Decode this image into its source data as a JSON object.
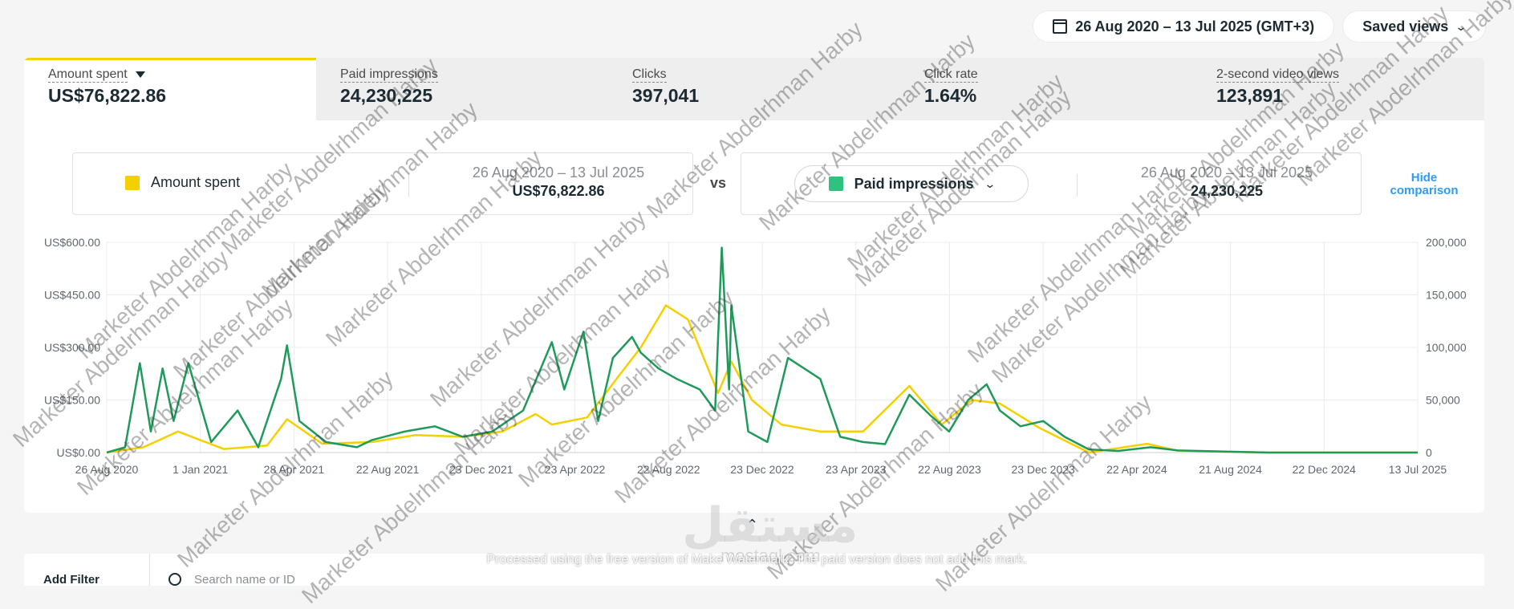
{
  "topbar": {
    "date_range": "26 Aug 2020 – 13 Jul 2025 (GMT+3)",
    "saved_views": "Saved views"
  },
  "metrics": [
    {
      "label": "Amount spent",
      "value": "US$76,822.86"
    },
    {
      "label": "Paid impressions",
      "value": "24,230,225"
    },
    {
      "label": "Clicks",
      "value": "397,041"
    },
    {
      "label": "Click rate",
      "value": "1.64%"
    },
    {
      "label": "2-second video views",
      "value": "123,891"
    }
  ],
  "comparison": {
    "left_metric": "Amount spent",
    "left_range": "26 Aug 2020 – 13 Jul 2025",
    "left_value": "US$76,822.86",
    "vs": "vs",
    "right_metric": "Paid impressions",
    "right_range": "26 Aug 2020 – 13 Jul 2025",
    "right_value": "24,230,225",
    "hide": "Hide comparison"
  },
  "colors": {
    "spend": "#f5d000",
    "impressions": "#1f9a5b"
  },
  "chart_data": {
    "type": "line",
    "x_ticks": [
      "26 Aug 2020",
      "1 Jan 2021",
      "28 Apr 2021",
      "22 Aug 2021",
      "23 Dec 2021",
      "23 Apr 2022",
      "22 Aug 2022",
      "23 Dec 2022",
      "23 Apr 2023",
      "22 Aug 2023",
      "23 Dec 2023",
      "22 Apr 2024",
      "21 Aug 2024",
      "22 Dec 2024",
      "13 Jul 2025"
    ],
    "y_left_ticks": [
      "US$0.00",
      "US$150.00",
      "US$300.00",
      "US$450.00",
      "US$600.00"
    ],
    "y_left_range": [
      0,
      600
    ],
    "y_right_ticks": [
      "0",
      "50,000",
      "100,000",
      "150,000",
      "200,000"
    ],
    "y_right_range": [
      0,
      200000
    ],
    "series": [
      {
        "name": "Amount spent",
        "axis": "left",
        "x": [
          "2020-08-26",
          "2020-10-15",
          "2020-12-01",
          "2021-02-01",
          "2021-04-01",
          "2021-04-28",
          "2021-06-15",
          "2021-08-22",
          "2021-10-20",
          "2021-12-23",
          "2022-02-15",
          "2022-04-01",
          "2022-04-23",
          "2022-06-10",
          "2022-07-20",
          "2022-08-22",
          "2022-09-25",
          "2022-10-25",
          "2022-12-05",
          "2022-12-23",
          "2023-01-20",
          "2023-03-01",
          "2023-04-23",
          "2023-06-20",
          "2023-08-22",
          "2023-10-05",
          "2023-11-15",
          "2023-12-23",
          "2024-02-15",
          "2024-04-22",
          "2024-07-10",
          "2024-08-21",
          "2024-12-22",
          "2025-07-13"
        ],
        "values": [
          0,
          15,
          60,
          10,
          20,
          95,
          25,
          30,
          50,
          45,
          60,
          110,
          80,
          100,
          210,
          300,
          420,
          380,
          170,
          260,
          150,
          80,
          60,
          60,
          190,
          80,
          150,
          140,
          70,
          0,
          25,
          5,
          0,
          0
        ]
      },
      {
        "name": "Paid impressions",
        "axis": "right",
        "x": [
          "2020-08-26",
          "2020-09-20",
          "2020-10-10",
          "2020-10-25",
          "2020-11-10",
          "2020-11-25",
          "2020-12-15",
          "2021-01-15",
          "2021-02-20",
          "2021-03-20",
          "2021-04-20",
          "2021-04-28",
          "2021-05-15",
          "2021-06-20",
          "2021-08-01",
          "2021-08-22",
          "2021-10-05",
          "2021-11-15",
          "2021-12-23",
          "2022-02-01",
          "2022-03-15",
          "2022-04-23",
          "2022-05-10",
          "2022-06-05",
          "2022-06-25",
          "2022-07-15",
          "2022-08-10",
          "2022-08-22",
          "2022-09-15",
          "2022-10-10",
          "2022-11-10",
          "2022-12-01",
          "2022-12-10",
          "2022-12-20",
          "2022-12-23",
          "2023-01-15",
          "2023-02-10",
          "2023-03-10",
          "2023-04-23",
          "2023-05-20",
          "2023-06-20",
          "2023-07-20",
          "2023-08-22",
          "2023-09-20",
          "2023-10-15",
          "2023-11-10",
          "2023-12-05",
          "2023-12-23",
          "2024-01-20",
          "2024-02-20",
          "2024-03-20",
          "2024-04-22",
          "2024-06-01",
          "2024-07-15",
          "2024-08-21",
          "2024-12-22",
          "2025-07-13"
        ],
        "values": [
          0,
          5000,
          85000,
          20000,
          80000,
          30000,
          85000,
          10000,
          40000,
          5000,
          70000,
          102000,
          30000,
          10000,
          5000,
          12000,
          20000,
          25000,
          15000,
          20000,
          40000,
          105000,
          60000,
          115000,
          30000,
          90000,
          110000,
          95000,
          80000,
          70000,
          60000,
          40000,
          195000,
          60000,
          140000,
          20000,
          10000,
          90000,
          70000,
          15000,
          10000,
          8000,
          55000,
          35000,
          20000,
          50000,
          65000,
          40000,
          25000,
          30000,
          15000,
          3000,
          1500,
          5000,
          2000,
          0,
          0
        ]
      }
    ]
  },
  "footer": {
    "add_filter": "Add Filter",
    "search_placeholder": "Search name or ID"
  },
  "watermark": {
    "text": "Marketer Abdelrhman Harby",
    "site": "مستقل",
    "site_latin": "mostaql.com",
    "notice": "Processed using the free version of Make Watermark. The paid version does not add this mark."
  }
}
